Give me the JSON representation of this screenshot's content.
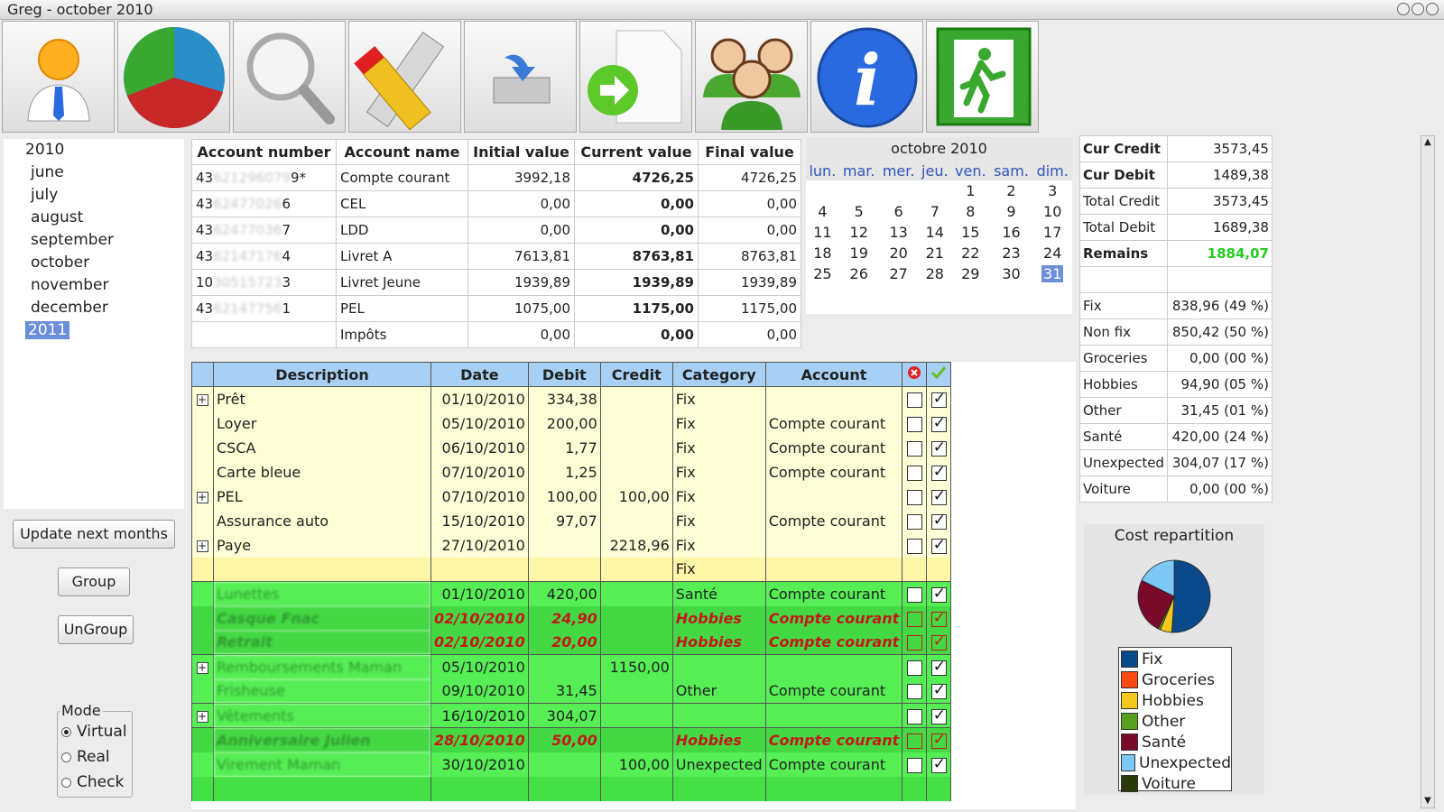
{
  "window": {
    "title": "Greg - october 2010"
  },
  "toolbar": [
    "user-icon",
    "pie-chart-icon",
    "magnifier-icon",
    "pencil-ruler-icon",
    "save-download-icon",
    "export-document-icon",
    "users-group-icon",
    "info-icon",
    "exit-icon"
  ],
  "months": {
    "year2010": "2010",
    "items": [
      "june",
      "july",
      "august",
      "september",
      "october",
      "november",
      "december"
    ],
    "year2011": "2011"
  },
  "buttons": {
    "update": "Update next months",
    "group": "Group",
    "ungroup": "UnGroup"
  },
  "mode": {
    "legend": "Mode",
    "options": [
      "Virtual",
      "Real",
      "Check"
    ],
    "selected": "Virtual"
  },
  "accounts": {
    "headers": [
      "Account number",
      "Account name",
      "Initial value",
      "Current value",
      "Final value"
    ],
    "rows": [
      {
        "pre": "43",
        "hidden": "621296079",
        "suf": "9*",
        "name": "Compte courant",
        "initial": "3992,18",
        "current": "4726,25",
        "final": "4726,25"
      },
      {
        "pre": "43",
        "hidden": "62477026",
        "suf": "6",
        "name": "CEL",
        "initial": "0,00",
        "current": "0,00",
        "final": "0,00"
      },
      {
        "pre": "43",
        "hidden": "62477036",
        "suf": "7",
        "name": "LDD",
        "initial": "0,00",
        "current": "0,00",
        "final": "0,00"
      },
      {
        "pre": "43",
        "hidden": "62147176",
        "suf": "4",
        "name": "Livret A",
        "initial": "7613,81",
        "current": "8763,81",
        "final": "8763,81"
      },
      {
        "pre": "10",
        "hidden": "30515723",
        "suf": "3",
        "name": "Livret Jeune",
        "initial": "1939,89",
        "current": "1939,89",
        "final": "1939,89"
      },
      {
        "pre": "43",
        "hidden": "62147756",
        "suf": "1",
        "name": "PEL",
        "initial": "1075,00",
        "current": "1175,00",
        "final": "1175,00"
      },
      {
        "pre": "",
        "hidden": "",
        "suf": "",
        "name": "Impôts",
        "initial": "0,00",
        "current": "0,00",
        "final": "0,00"
      }
    ]
  },
  "calendar": {
    "title": "octobre 2010",
    "days": [
      "lun.",
      "mar.",
      "mer.",
      "jeu.",
      "ven.",
      "sam.",
      "dim."
    ],
    "weeks": [
      [
        "",
        "",
        "",
        "",
        "1",
        "2",
        "3"
      ],
      [
        "4",
        "5",
        "6",
        "7",
        "8",
        "9",
        "10"
      ],
      [
        "11",
        "12",
        "13",
        "14",
        "15",
        "16",
        "17"
      ],
      [
        "18",
        "19",
        "20",
        "21",
        "22",
        "23",
        "24"
      ],
      [
        "25",
        "26",
        "27",
        "28",
        "29",
        "30",
        "31"
      ]
    ],
    "selected": "31"
  },
  "summary": {
    "rows": [
      {
        "k": "Cur Credit",
        "v": "3573,45",
        "bold": true
      },
      {
        "k": "Cur Debit",
        "v": "1489,38",
        "bold": true
      },
      {
        "k": "Total Credit",
        "v": "3573,45"
      },
      {
        "k": "Total Debit",
        "v": "1689,38"
      },
      {
        "k": "Remains",
        "v": "1884,07",
        "bold": true,
        "green": true
      },
      {
        "k": "",
        "v": ""
      },
      {
        "k": "Fix",
        "v": "838,96 (49 %)"
      },
      {
        "k": "Non fix",
        "v": "850,42 (50 %)"
      },
      {
        "k": "Groceries",
        "v": "0,00 (00 %)"
      },
      {
        "k": "Hobbies",
        "v": "94,90 (05 %)"
      },
      {
        "k": "Other",
        "v": "31,45 (01 %)"
      },
      {
        "k": "Santé",
        "v": "420,00 (24 %)"
      },
      {
        "k": "Unexpected",
        "v": "304,07 (17 %)"
      },
      {
        "k": "Voiture",
        "v": "0,00 (00 %)"
      }
    ]
  },
  "chart_data": {
    "type": "pie",
    "title": "Cost repartition",
    "legend_placement": "bottom",
    "slices": [
      {
        "name": "Fix",
        "value": 49,
        "color": "#0a4a8a"
      },
      {
        "name": "Groceries",
        "value": 0,
        "color": "#ff4a14"
      },
      {
        "name": "Hobbies",
        "value": 5,
        "color": "#f5c81e"
      },
      {
        "name": "Other",
        "value": 1,
        "color": "#5aa020"
      },
      {
        "name": "Santé",
        "value": 24,
        "color": "#7a0a2a"
      },
      {
        "name": "Unexpected",
        "value": 17,
        "color": "#7ec8f8"
      },
      {
        "name": "Voiture",
        "value": 0,
        "color": "#2a3a0a"
      }
    ]
  },
  "transactions": {
    "headers": [
      "Description",
      "Date",
      "Debit",
      "Credit",
      "Category",
      "Account"
    ],
    "rows": [
      {
        "style": "y",
        "expand": true,
        "desc": "Prêt",
        "date": "01/10/2010",
        "debit": "334,38",
        "credit": "",
        "cat": "Fix",
        "acct": "",
        "c1": false,
        "c2": true
      },
      {
        "style": "y",
        "expand": false,
        "desc": "Loyer",
        "date": "05/10/2010",
        "debit": "200,00",
        "credit": "",
        "cat": "Fix",
        "acct": "Compte courant",
        "c1": false,
        "c2": true
      },
      {
        "style": "y",
        "expand": false,
        "desc": "CSCA",
        "date": "06/10/2010",
        "debit": "1,77",
        "credit": "",
        "cat": "Fix",
        "acct": "Compte courant",
        "c1": false,
        "c2": true
      },
      {
        "style": "y",
        "expand": false,
        "desc": "Carte bleue",
        "date": "07/10/2010",
        "debit": "1,25",
        "credit": "",
        "cat": "Fix",
        "acct": "Compte courant",
        "c1": false,
        "c2": true
      },
      {
        "style": "y",
        "expand": true,
        "desc": "PEL",
        "date": "07/10/2010",
        "debit": "100,00",
        "credit": "100,00",
        "cat": "Fix",
        "acct": "",
        "c1": false,
        "c2": true
      },
      {
        "style": "y",
        "expand": false,
        "desc": "Assurance auto",
        "date": "15/10/2010",
        "debit": "97,07",
        "credit": "",
        "cat": "Fix",
        "acct": "Compte courant",
        "c1": false,
        "c2": true
      },
      {
        "style": "y",
        "expand": true,
        "desc": "Paye",
        "date": "27/10/2010",
        "debit": "",
        "credit": "2218,96",
        "cat": "Fix",
        "acct": "",
        "c1": false,
        "c2": true
      },
      {
        "style": "y2",
        "expand": false,
        "desc": "",
        "date": "",
        "debit": "",
        "credit": "",
        "cat": "Fix",
        "acct": "",
        "c1": null,
        "c2": null
      },
      {
        "style": "g",
        "expand": false,
        "blur": true,
        "desc": "Lunettes",
        "date": "01/10/2010",
        "debit": "420,00",
        "credit": "",
        "cat": "Santé",
        "acct": "Compte courant",
        "c1": false,
        "c2": true
      },
      {
        "style": "gd",
        "expand": false,
        "blur": true,
        "desc": "Casque Fnac",
        "date": "02/10/2010",
        "debit": "24,90",
        "credit": "",
        "cat": "Hobbies",
        "acct": "Compte courant",
        "c1": false,
        "c2": true
      },
      {
        "style": "gd",
        "expand": false,
        "blur": true,
        "desc": "Retrait",
        "date": "02/10/2010",
        "debit": "20,00",
        "credit": "",
        "cat": "Hobbies",
        "acct": "Compte courant",
        "c1": false,
        "c2": true
      },
      {
        "style": "g",
        "sep": true,
        "expand": true,
        "blur": true,
        "desc": "Remboursements Maman",
        "date": "05/10/2010",
        "debit": "",
        "credit": "1150,00",
        "cat": "",
        "acct": "",
        "c1": false,
        "c2": true
      },
      {
        "style": "g",
        "expand": false,
        "blur": true,
        "desc": "Frisheuse",
        "date": "09/10/2010",
        "debit": "31,45",
        "credit": "",
        "cat": "Other",
        "acct": "Compte courant",
        "c1": false,
        "c2": true
      },
      {
        "style": "g",
        "sep": true,
        "expand": true,
        "blur": true,
        "desc": "Vêtements",
        "date": "16/10/2010",
        "debit": "304,07",
        "credit": "",
        "cat": "",
        "acct": "",
        "c1": false,
        "c2": true
      },
      {
        "style": "gd",
        "sep": true,
        "expand": false,
        "blur": true,
        "desc": "Anniversaire Julien",
        "date": "28/10/2010",
        "debit": "50,00",
        "credit": "",
        "cat": "Hobbies",
        "acct": "Compte courant",
        "c1": false,
        "c2": true
      },
      {
        "style": "g",
        "expand": false,
        "blur": true,
        "desc": "Virement Maman",
        "date": "30/10/2010",
        "debit": "",
        "credit": "100,00",
        "cat": "Unexpected",
        "acct": "Compte courant",
        "c1": false,
        "c2": true
      }
    ]
  }
}
